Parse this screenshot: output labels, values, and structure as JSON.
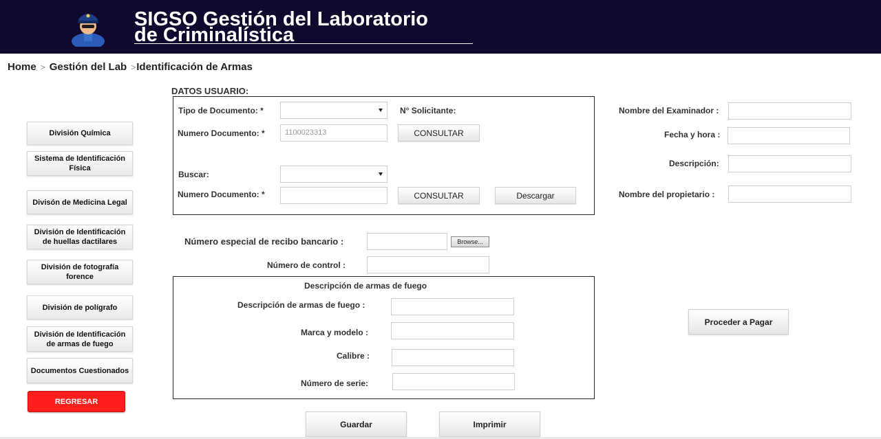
{
  "header": {
    "title_line1": "SIGSO  Gestión del Laboratorio",
    "title_line2": "de Criminalística"
  },
  "breadcrumb": {
    "home": "Home",
    "sep": ">",
    "lab": "Gestión del Lab",
    "current": "Identificación de Armas"
  },
  "sidebar": {
    "items": [
      {
        "label": "División Química"
      },
      {
        "label": "Sistema de Identificación Física"
      },
      {
        "label": "Divisón de Medicina Legal"
      },
      {
        "label": "División de Identificación de huellas dactilares"
      },
      {
        "label": "División de fotografía forence"
      },
      {
        "label": "División de polígrafo"
      },
      {
        "label": "División de Identificación de armas de fuego"
      },
      {
        "label": "Documentos Cuestionados"
      }
    ],
    "back_label": "REGRESAR",
    "back_color": "#ff1d1d"
  },
  "user_data": {
    "section_title": "DATOS USUARIO:",
    "doc_type_label": "Tipo de Documento: *",
    "requester_label": "N° Solicitante:",
    "doc_number_label": "Numero Documento: *",
    "doc_number_value": "1100023313",
    "consult_label": "CONSULTAR",
    "search_label": "Buscar:",
    "doc_number2_label": "Numero Documento: *",
    "consult2_label": "CONSULTAR",
    "download_label": "Descargar"
  },
  "right_panel": {
    "examiner_label": "Nombre del Examinador :",
    "datetime_label": "Fecha y hora :",
    "description_label": "Descripción:",
    "owner_label": "Nombre del propietario :",
    "pay_label": "Proceder a Pagar"
  },
  "payment": {
    "receipt_label": "Número especial de recibo bancario :",
    "browse_label": "Browse...",
    "control_label": "Número de control :"
  },
  "firearms": {
    "section_title": "Descripción de armas de fuego",
    "description_label": "Descripción de armas de fuego :",
    "brand_label": "Marca y modelo :",
    "caliber_label": "Calibre :",
    "serial_label": "Número de serie:"
  },
  "actions": {
    "save_label": "Guardar",
    "print_label": "Imprimir"
  },
  "colors": {
    "header_bg": "#0f0a2d"
  }
}
